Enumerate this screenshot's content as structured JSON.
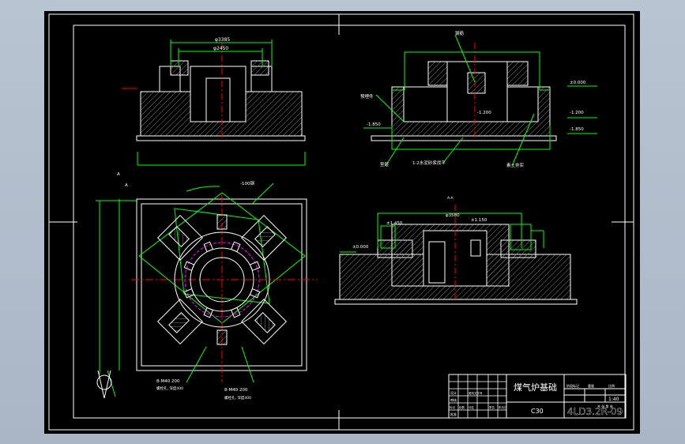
{
  "colors": {
    "background": "#000000",
    "outline": "#ffffff",
    "dimension": "#00ff00",
    "center_line": "#ff0000",
    "hidden": "#ff00ff",
    "hatch": "#7f7f7f",
    "window_frame": "#aab6c6"
  },
  "front_view": {
    "dim_outer": "φ3385",
    "dim_inner": "φ2450"
  },
  "section_view": {
    "leader_top": "钢筋",
    "leader_left": "预埋件",
    "level_top": "±0.000",
    "level_mid": "-1.200",
    "level_right": "-1.850",
    "level_left": "-1.850",
    "level_center": "-1.200",
    "leader_bottom_left": "垫层",
    "leader_bottom_mid": "1:2水泥砂浆找平",
    "leader_bottom_right": "素土夯实"
  },
  "elevation_view": {
    "label_top": "A-A",
    "dim_top": "φ3580",
    "level_left_top": "±1.450",
    "level_right_top": "±1.150",
    "level_left": "±0.000"
  },
  "plan_view": {
    "label_top_left": "A",
    "label_mid_left": "A",
    "dim_top": "-100钢",
    "bolt_left": "8-M40 200",
    "bolt_left_note": "螺栓孔, 深度400",
    "bolt_right": "8-M40 200",
    "bolt_right_note": "螺栓孔, 深度400"
  },
  "title_block": {
    "drawing_title": "煤气炉基础",
    "material": "C30",
    "drawing_number": "4LD3.2R-09",
    "scale": "1:40",
    "sheet_labels": [
      "阶段标记",
      "重量",
      "比例"
    ],
    "designer": "设计",
    "checker": "审核",
    "approver": "批准",
    "sheets": "共 张 第 张",
    "row_labels": [
      "标记",
      "处数",
      "分区",
      "更改文件号",
      "签名",
      "年月日"
    ]
  }
}
